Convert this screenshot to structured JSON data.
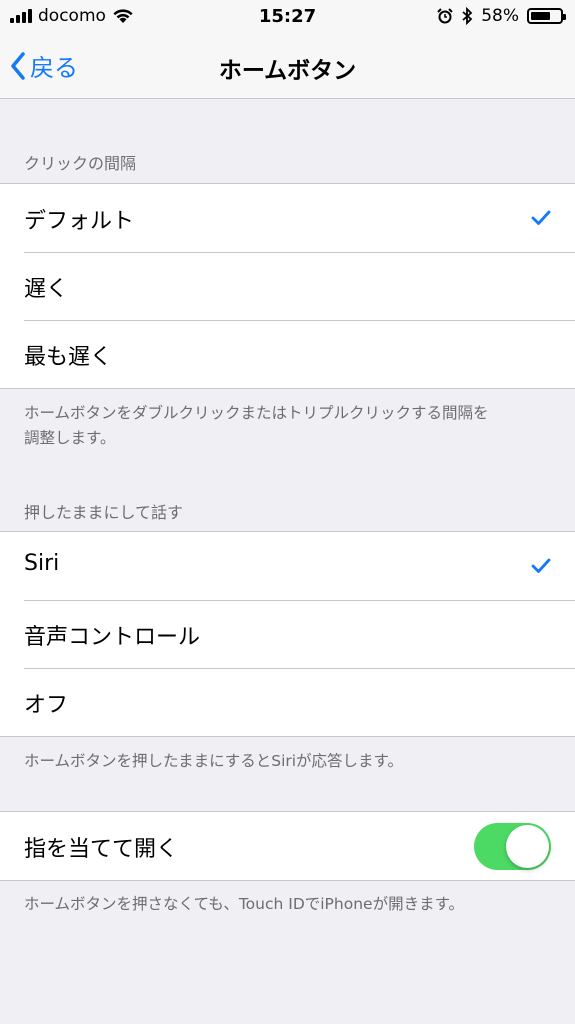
{
  "status_bar": {
    "carrier": "docomo",
    "time": "15:27",
    "battery_percent": "58%",
    "battery_level": 0.58
  },
  "nav": {
    "back_label": "戻る",
    "title": "ホームボタン"
  },
  "click_speed": {
    "header": "クリックの間隔",
    "options": [
      "デフォルト",
      "遅く",
      "最も遅く"
    ],
    "selected_index": 0,
    "footer": "ホームボタンをダブルクリックまたはトリプルクリックする間隔を調整します。"
  },
  "press_and_hold": {
    "header": "押したままにして話す",
    "options": [
      "Siri",
      "音声コントロール",
      "オフ"
    ],
    "selected_index": 0,
    "footer": "ホームボタンを押したままにするとSiriが応答します。"
  },
  "rest_finger": {
    "label": "指を当てて開く",
    "enabled": true,
    "footer": "ホームボタンを押さなくても、Touch IDでiPhoneが開きます。"
  },
  "colors": {
    "accent": "#1479f7",
    "toggle_on": "#4cd964",
    "background": "#efeff4",
    "secondary_text": "#6d6d72"
  }
}
